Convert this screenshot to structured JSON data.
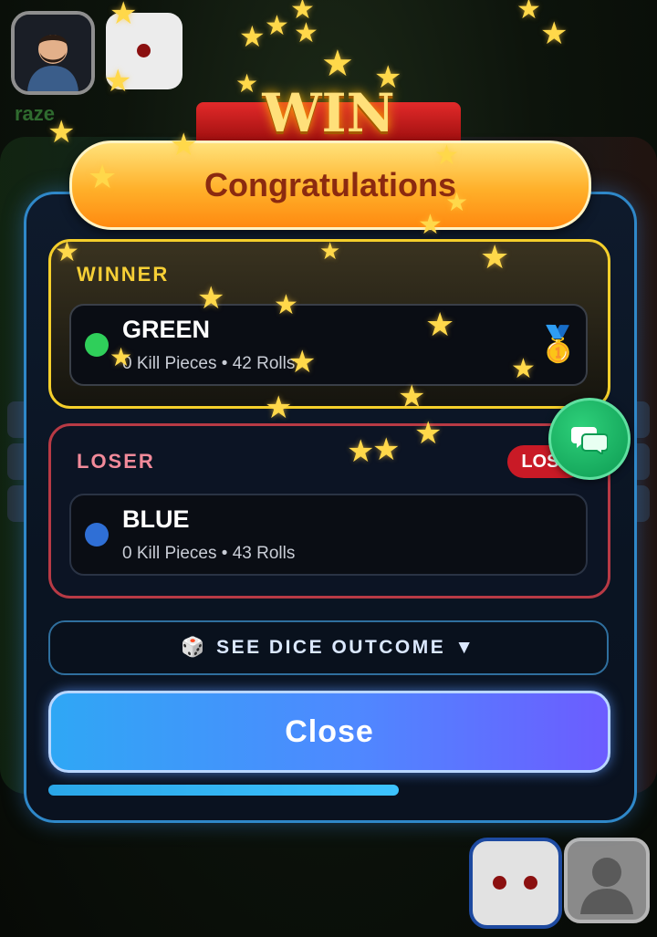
{
  "player_top": {
    "name": "raze"
  },
  "banner": {
    "win_text": "WIN",
    "title": "Congratulations"
  },
  "winner": {
    "section_label": "WINNER",
    "player": "GREEN",
    "stats": "0 Kill Pieces • 42 Rolls",
    "color": "#2fcf5a",
    "medal_icon": "🥇"
  },
  "loser": {
    "section_label": "LOSER",
    "badge": "LOST",
    "player": "BLUE",
    "stats": "0 Kill Pieces • 43 Rolls",
    "color": "#2f6fd6"
  },
  "dice_outcome": {
    "label": "SEE DICE OUTCOME",
    "icon": "🎲",
    "arrow": "▼"
  },
  "close_button": {
    "label": "Close"
  },
  "progress": {
    "fraction": 0.63
  },
  "colors": {
    "accent_blue": "#2f88c9",
    "winner_gold": "#f5cf2b",
    "loser_red": "#b83a45",
    "chat_green": "#1fb56a"
  }
}
